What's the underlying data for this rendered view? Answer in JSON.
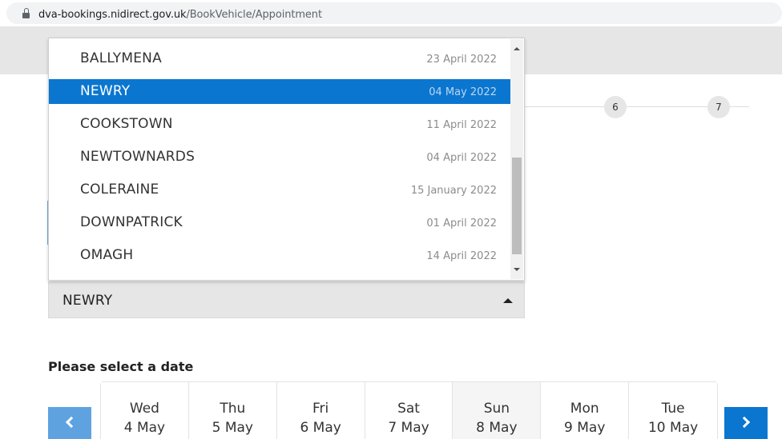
{
  "browser": {
    "url_host": "dva-bookings.nidirect.gov.uk",
    "url_path": "/BookVehicle/Appointment"
  },
  "stepper": {
    "steps": [
      "6",
      "7"
    ]
  },
  "centre_select": {
    "selected_value": "NEWRY",
    "options": [
      {
        "name": "BALLYMENA",
        "date": "23 April 2022",
        "selected": false
      },
      {
        "name": "NEWRY",
        "date": "04 May 2022",
        "selected": true
      },
      {
        "name": "COOKSTOWN",
        "date": "11 April 2022",
        "selected": false
      },
      {
        "name": "NEWTOWNARDS",
        "date": "04 April 2022",
        "selected": false
      },
      {
        "name": "COLERAINE",
        "date": "15 January 2022",
        "selected": false
      },
      {
        "name": "DOWNPATRICK",
        "date": "01 April 2022",
        "selected": false
      },
      {
        "name": "OMAGH",
        "date": "14 April 2022",
        "selected": false
      }
    ]
  },
  "date_picker": {
    "heading": "Please select a date",
    "prev_icon": "chevron-left-icon",
    "next_icon": "chevron-right-icon",
    "days": [
      {
        "dow": "Wed",
        "date": "4 May",
        "unavailable": false
      },
      {
        "dow": "Thu",
        "date": "5 May",
        "unavailable": false
      },
      {
        "dow": "Fri",
        "date": "6 May",
        "unavailable": false
      },
      {
        "dow": "Sat",
        "date": "7 May",
        "unavailable": false
      },
      {
        "dow": "Sun",
        "date": "8 May",
        "unavailable": true
      },
      {
        "dow": "Mon",
        "date": "9 May",
        "unavailable": false
      },
      {
        "dow": "Tue",
        "date": "10 May",
        "unavailable": false
      }
    ]
  },
  "colors": {
    "accent_blue": "#0b76d0",
    "disabled_blue": "#5ea3e0",
    "header_gray": "#e6e6e6"
  }
}
